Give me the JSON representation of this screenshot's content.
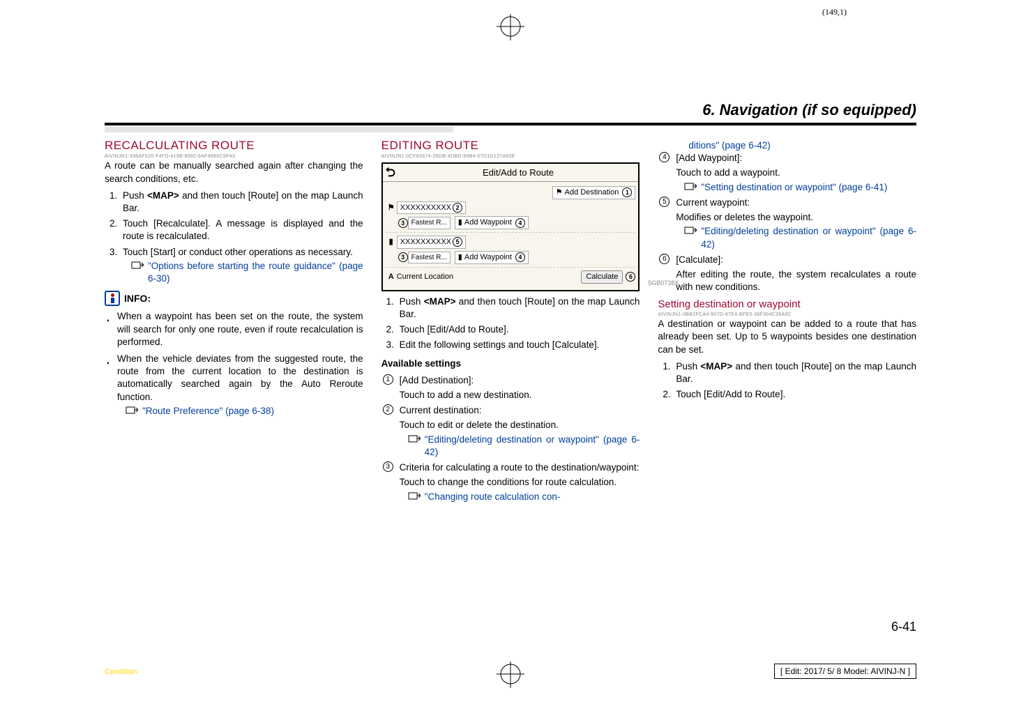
{
  "top_page_indicator": "(149,1)",
  "section_title": "6. Navigation (if so equipped)",
  "col1": {
    "h2": "RECALCULATING ROUTE",
    "h2_uid": "AIVINJN1-338AF520-F4FD-419B-8060-6AF4890C9F43",
    "intro": "A route can be manually searched again after changing the search conditions, etc.",
    "steps": [
      {
        "pre": "Push ",
        "bold": "<MAP>",
        "post": " and then touch [Route] on the map Launch Bar."
      },
      {
        "text": "Touch [Recalculate]. A message is displayed and the route is recalculated."
      },
      {
        "text": "Touch [Start] or conduct other operations as necessary.",
        "ref": "\"Options before starting the route guidance\" (page 6-30)"
      }
    ],
    "info_label": "INFO:",
    "bullets": [
      "When a waypoint has been set on the route, the system will search for only one route, even if route recalculation is performed.",
      "When the vehicle deviates from the suggested route, the route from the current location to the destination is automatically searched again by the Auto Reroute function."
    ],
    "bullet_ref": "\"Route Preference\" (page 6-38)"
  },
  "col2": {
    "h2": "EDITING ROUTE",
    "h2_uid": "AIVINJN1-0CFA5674-26DB-4DBD-94B4-07D1D137A60E",
    "sshot": {
      "title": "Edit/Add to Route",
      "add_dest": "Add Destination",
      "dest_text": "XXXXXXXXXX",
      "fastest": "Fastest R...",
      "add_wp": "Add Waypoint",
      "wp_text": "XXXXXXXXXX",
      "cur_loc": "Current Location",
      "calculate": "Calculate",
      "img_id": "5GB0738X"
    },
    "steps": [
      {
        "pre": "Push ",
        "bold": "<MAP>",
        "post": " and then touch [Route] on the map Launch Bar."
      },
      {
        "text": "Touch [Edit/Add to Route]."
      },
      {
        "text": "Edit the following settings and touch [Calculate]."
      }
    ],
    "avail": "Available settings",
    "items": [
      {
        "n": "1",
        "label": "[Add Destination]:",
        "desc": "Touch to add a new destination."
      },
      {
        "n": "2",
        "label": "Current destination:",
        "desc": "Touch to edit or delete the destination.",
        "ref": "\"Editing/deleting destination or waypoint\" (page 6-42)"
      },
      {
        "n": "3",
        "label": "Criteria for calculating a route to the destination/waypoint:",
        "desc": "Touch to change the conditions for route calculation.",
        "ref": "\"Changing route calculation con-"
      }
    ]
  },
  "col3": {
    "cont_ref": "ditions\" (page 6-42)",
    "items": [
      {
        "n": "4",
        "label": "[Add Waypoint]:",
        "desc": "Touch to add a waypoint.",
        "ref": "\"Setting destination or waypoint\" (page 6-41)"
      },
      {
        "n": "5",
        "label": "Current waypoint:",
        "desc": "Modifies or deletes the waypoint.",
        "ref": "\"Editing/deleting destination or waypoint\" (page 6-42)"
      },
      {
        "n": "6",
        "label": "[Calculate]:",
        "desc": "After editing the route, the system recalculates a route with new conditions."
      }
    ],
    "h3": "Setting destination or waypoint",
    "h3_uid": "AIVINJN1-0BB2FCA4-907D-47E4-BFE0-38F304C36A5C",
    "intro": "A destination or waypoint can be added to a route that has already been set. Up to 5 waypoints besides one destination can be set.",
    "steps": [
      {
        "pre": "Push ",
        "bold": "<MAP>",
        "post": " and then touch [Route] on the map Launch Bar."
      },
      {
        "text": "Touch [Edit/Add to Route]."
      }
    ]
  },
  "page_num": "6-41",
  "condition": "Condition:",
  "edit_stamp": "[ Edit: 2017/ 5/ 8    Model:  AIVINJ-N ]"
}
